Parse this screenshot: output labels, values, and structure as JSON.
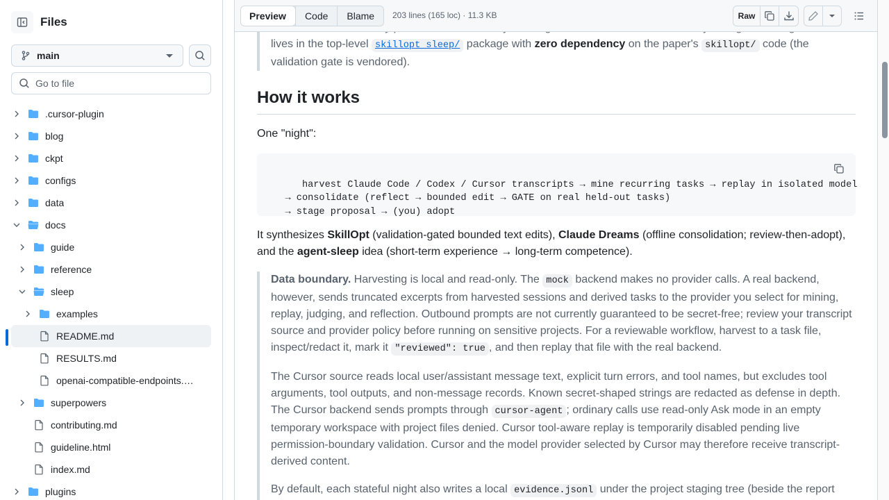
{
  "sidebar": {
    "title": "Files",
    "branch": "main",
    "go_to_file_placeholder": "Go to file",
    "tree": [
      {
        "name": ".cursor-plugin",
        "type": "folder",
        "depth": 0,
        "expanded": false
      },
      {
        "name": "blog",
        "type": "folder",
        "depth": 0,
        "expanded": false
      },
      {
        "name": "ckpt",
        "type": "folder",
        "depth": 0,
        "expanded": false
      },
      {
        "name": "configs",
        "type": "folder",
        "depth": 0,
        "expanded": false
      },
      {
        "name": "data",
        "type": "folder",
        "depth": 0,
        "expanded": false
      },
      {
        "name": "docs",
        "type": "folder",
        "depth": 0,
        "expanded": true
      },
      {
        "name": "guide",
        "type": "folder",
        "depth": 1,
        "expanded": false
      },
      {
        "name": "reference",
        "type": "folder",
        "depth": 1,
        "expanded": false
      },
      {
        "name": "sleep",
        "type": "folder",
        "depth": 1,
        "expanded": true
      },
      {
        "name": "examples",
        "type": "folder",
        "depth": 2,
        "expanded": false
      },
      {
        "name": "README.md",
        "type": "file",
        "depth": 2,
        "selected": true
      },
      {
        "name": "RESULTS.md",
        "type": "file",
        "depth": 2
      },
      {
        "name": "openai-compatible-endpoints.…",
        "type": "file",
        "depth": 2
      },
      {
        "name": "superpowers",
        "type": "folder",
        "depth": 1,
        "expanded": false
      },
      {
        "name": "contributing.md",
        "type": "file",
        "depth": 1
      },
      {
        "name": "guideline.html",
        "type": "file",
        "depth": 1
      },
      {
        "name": "index.md",
        "type": "file",
        "depth": 1
      },
      {
        "name": "plugins",
        "type": "folder",
        "depth": 0,
        "expanded": false
      }
    ]
  },
  "toolbar": {
    "tabs": [
      "Preview",
      "Code",
      "Blame"
    ],
    "active_tab": "Preview",
    "file_info": "203 lines (165 loc) · 11.3 KB",
    "raw_label": "Raw"
  },
  "content": {
    "intro_top_partial": "Preview. This is an early preview we are actively iterating on; interfaces and defaults may change. The engine",
    "intro_line2_a": "lives in the top-level ",
    "intro_pkg": "skillopt_sleep/",
    "intro_line2_b": " package with ",
    "intro_zero_dep": "zero dependency",
    "intro_line2_c": " on the paper's ",
    "intro_paper_code": "skillopt/",
    "intro_line2_d": " code (the",
    "intro_line3": "validation gate is vendored).",
    "h2": "How it works",
    "one_night": "One \"night\":",
    "code_block": "harvest Claude Code / Codex / Cursor transcripts → mine recurring tasks → replay in isolated model\n   → consolidate (reflect → bounded edit → GATE on real held-out tasks)\n   → stage proposal → (you) adopt",
    "synth_a": "It synthesizes ",
    "synth_skillopt": "SkillOpt",
    "synth_b": " (validation-gated bounded text edits), ",
    "synth_dreams": "Claude Dreams",
    "synth_c": " (offline consolidation; review-then-adopt), and the ",
    "synth_agent_sleep": "agent-sleep",
    "synth_d": " idea (short-term experience → long-term competence).",
    "boundary_title": "Data boundary.",
    "boundary_a": " Harvesting is local and read-only. The ",
    "boundary_mock": "mock",
    "boundary_b": " backend makes no provider calls. A real backend, however, sends truncated excerpts from harvested sessions and derived tasks to the provider you select for mining, replay, judging, and reflection. Outbound prompts are not currently guaranteed to be secret-free; review your transcript source and provider policy before running on sensitive projects. For a reviewable workflow, harvest to a task file, inspect/redact it, mark it ",
    "boundary_reviewed": "\"reviewed\": true",
    "boundary_c": ", and then replay that file with the real backend.",
    "cursor_a": "The Cursor source reads local user/assistant message text, explicit turn errors, and tool names, but excludes tool arguments, tool outputs, and non-message records. Known secret-shaped strings are redacted as defense in depth. The Cursor backend sends prompts through ",
    "cursor_agent": "cursor-agent",
    "cursor_b": "; ordinary calls use read-only Ask mode in an empty temporary workspace with project files denied. Cursor tool-aware replay is temporarily disabled pending live permission-boundary validation. Cursor and the model provider selected by Cursor may therefore receive transcript-derived content.",
    "default_a": "By default, each stateful night also writes a local ",
    "default_evidence": "evidence.jsonl",
    "default_b": " under the project staging tree (beside the",
    "default_c": "report when one is staged); dry-runs write evidence under the configured Sleep state directory. The log contains"
  }
}
